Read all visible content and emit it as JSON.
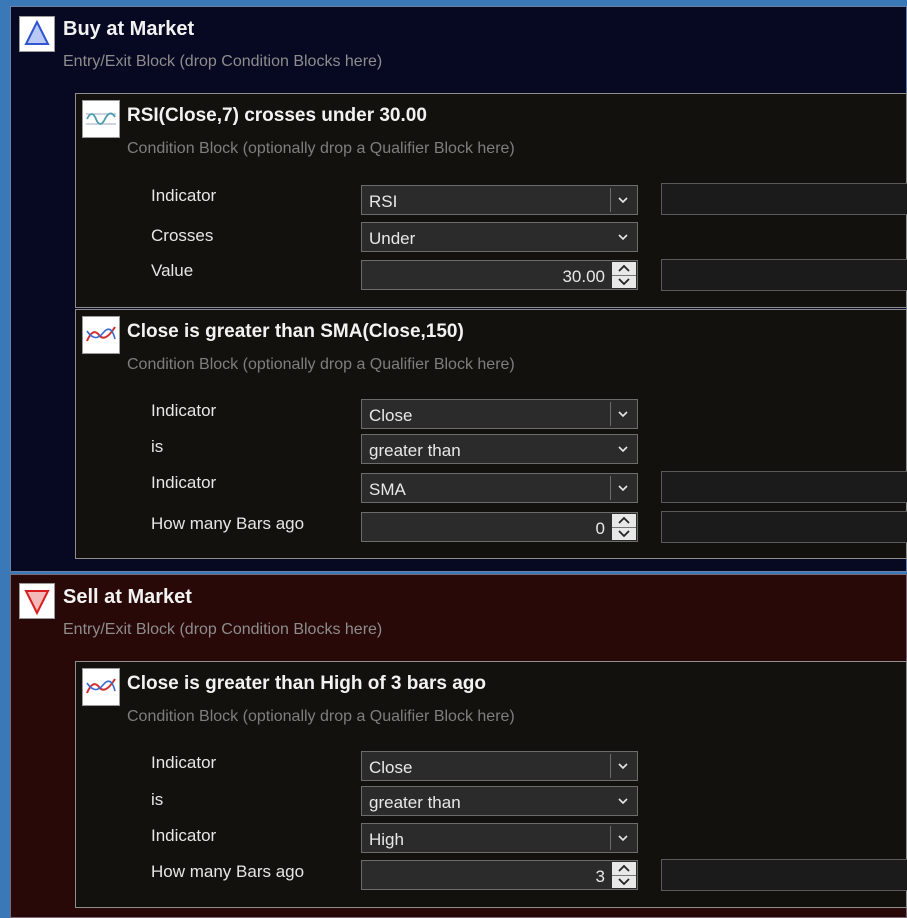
{
  "buy": {
    "title": "Buy at Market",
    "subtitle": "Entry/Exit Block (drop Condition Blocks here)",
    "conditions": [
      {
        "title": "RSI(Close,7) crosses under 30.00",
        "subtitle": "Condition Block (optionally drop a Qualifier Block here)",
        "fields": [
          {
            "label": "Indicator",
            "value": "RSI"
          },
          {
            "label": "Crosses",
            "value": "Under"
          },
          {
            "label": "Value",
            "value": "30.00"
          }
        ]
      },
      {
        "title": "Close is greater than SMA(Close,150)",
        "subtitle": "Condition Block (optionally drop a Qualifier Block here)",
        "fields": [
          {
            "label": "Indicator",
            "value": "Close"
          },
          {
            "label": "is",
            "value": "greater than"
          },
          {
            "label": "Indicator",
            "value": "SMA"
          },
          {
            "label": "How many Bars ago",
            "value": "0"
          }
        ]
      }
    ]
  },
  "sell": {
    "title": "Sell at Market",
    "subtitle": "Entry/Exit Block (drop Condition Blocks here)",
    "conditions": [
      {
        "title": "Close is greater than High of 3 bars ago",
        "subtitle": "Condition Block (optionally drop a Qualifier Block here)",
        "fields": [
          {
            "label": "Indicator",
            "value": "Close"
          },
          {
            "label": "is",
            "value": "greater than"
          },
          {
            "label": "Indicator",
            "value": "High"
          },
          {
            "label": "How many Bars ago",
            "value": "3"
          }
        ]
      }
    ]
  },
  "icons": {
    "buy": "triangle-up-icon",
    "sell": "triangle-down-icon",
    "rsi_condition": "oscillator-chart-icon",
    "crossover_condition": "crossover-chart-icon",
    "dropdown": "chevron-down-icon",
    "spinner": "spin-arrows-icon"
  },
  "colors": {
    "buy_block_bg": "#070822",
    "sell_block_bg": "#290808",
    "condition_bg": "#12110d",
    "buy_triangle": "#3a64d8",
    "sell_triangle": "#e02424"
  }
}
